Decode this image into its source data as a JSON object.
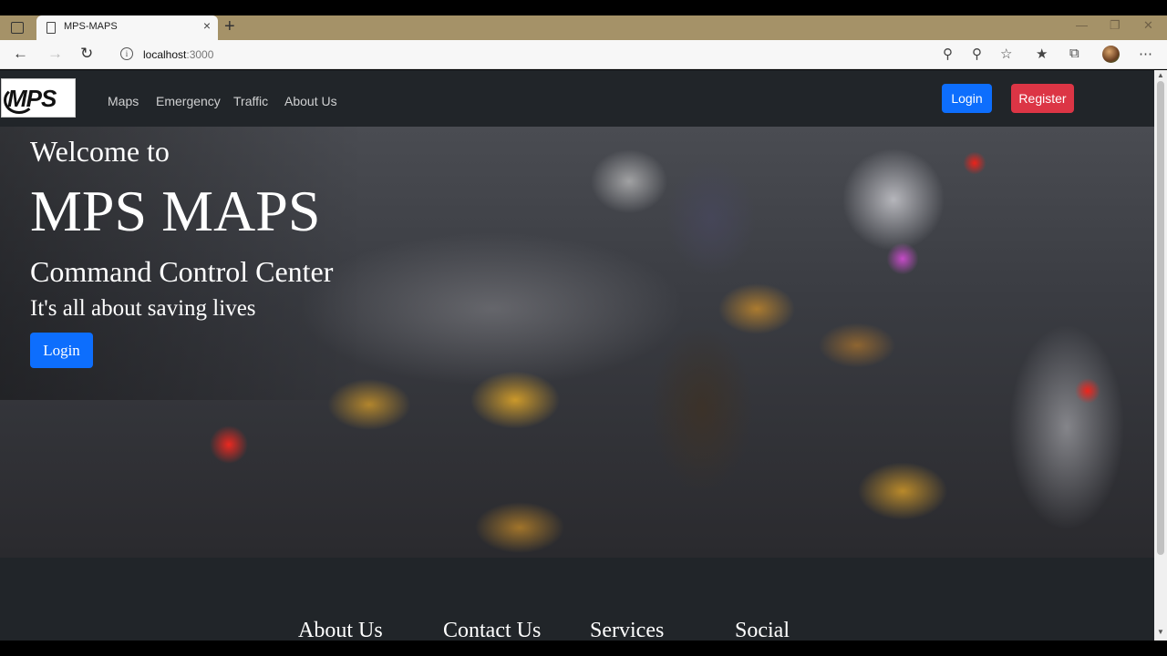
{
  "browser": {
    "tab_title": "MPS-MAPS",
    "tab_close": "×",
    "new_tab": "+",
    "url_host": "localhost",
    "url_port": ":3000",
    "window_controls": [
      "—",
      "❐",
      "✕"
    ],
    "icons": [
      "sidebar-icon",
      "doc-icon",
      "back-icon",
      "forward-icon",
      "refresh-icon",
      "info-icon",
      "location-icon",
      "key-icon",
      "favorite-add-icon",
      "favorites-icon",
      "collections-icon",
      "profile-avatar",
      "more-icon"
    ]
  },
  "site": {
    "logo_text": "MPS",
    "nav": [
      "Maps",
      "Emergency",
      "Traffic",
      "About Us"
    ],
    "login_label": "Login",
    "register_label": "Register",
    "colors": {
      "navbar": "#212529",
      "primary": "#0d6efd",
      "danger": "#dc3545"
    }
  },
  "hero": {
    "welcome": "Welcome to",
    "title": "MPS MAPS",
    "subtitle": "Command Control Center",
    "tagline": "It's all about saving lives",
    "button_label": "Login"
  },
  "footer": {
    "columns": [
      "About Us",
      "Contact Us",
      "Services",
      "Social"
    ]
  }
}
